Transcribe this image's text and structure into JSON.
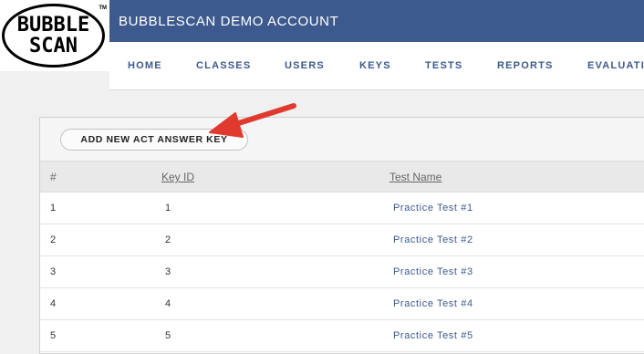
{
  "header": {
    "logo_line1": "BUBBLE",
    "logo_line2": "SCAN",
    "logo_tm": "TM",
    "account_title": "BUBBLESCAN DEMO ACCOUNT",
    "bg_color": "#3d5a8e"
  },
  "nav": {
    "items": [
      "HOME",
      "CLASSES",
      "USERS",
      "KEYS",
      "TESTS",
      "REPORTS",
      "EVALUATIO"
    ]
  },
  "toolbar": {
    "add_label": "ADD NEW ACT ANSWER KEY"
  },
  "table": {
    "headers": [
      "#",
      "Key ID",
      "Test Name"
    ],
    "rows": [
      {
        "num": "1",
        "key_id": "1",
        "test_name": "Practice Test #1"
      },
      {
        "num": "2",
        "key_id": "2",
        "test_name": "Practice Test #2"
      },
      {
        "num": "3",
        "key_id": "3",
        "test_name": "Practice Test #3"
      },
      {
        "num": "4",
        "key_id": "4",
        "test_name": "Practice Test #4"
      },
      {
        "num": "5",
        "key_id": "5",
        "test_name": "Practice Test #5"
      }
    ]
  },
  "annotation": {
    "arrow_color": "#e03a2f",
    "arrow_icon": "red-pointer-arrow-icon"
  }
}
